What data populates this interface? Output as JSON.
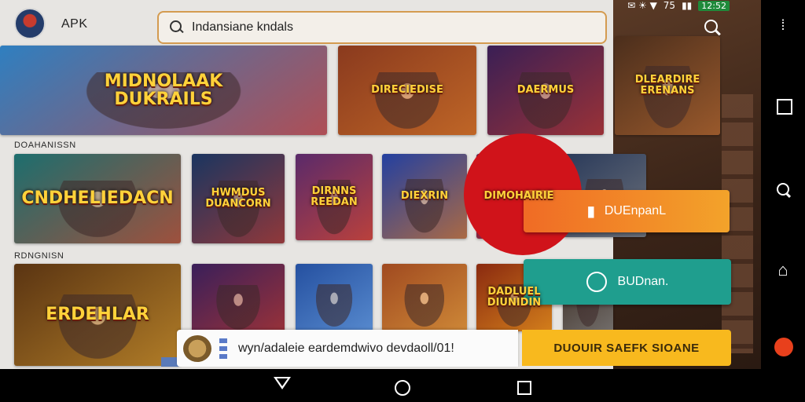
{
  "status_bar": {
    "time_text": "75",
    "battery_text": "12:52"
  },
  "header": {
    "app_name": "APK",
    "search_value": "Indansiane kndals"
  },
  "sections": {
    "first_label": "DOAHANISSN",
    "second_label": "RDNGNISN"
  },
  "hero_cards": [
    {
      "title": "MIDNOLAAK\nDUKRAILS",
      "bg": "#2f7fc0",
      "accent": "#e23b2b"
    },
    {
      "title": "DIRECIEDISE",
      "bg": "#8a3a1e",
      "accent": "#d4772a"
    },
    {
      "title": "DAERMUS",
      "bg": "#3a1f55",
      "accent": "#c0392b"
    },
    {
      "title": "DLEARDIRE\nERENANS",
      "bg": "#4b2e1c",
      "accent": "#b86a32"
    }
  ],
  "row1_cards": [
    {
      "title": "CNDHELIEDACN",
      "bg": "#1d6e6e",
      "accent": "#d2452a"
    },
    {
      "title": "HWMDUS\nDUANCORN",
      "bg": "#1a3560",
      "accent": "#c0392b"
    },
    {
      "title": "DIRNNS\nREEDAN",
      "bg": "#5a2a6a",
      "accent": "#e04a2a"
    },
    {
      "title": "DIEXRIN",
      "bg": "#2340a0",
      "accent": "#e07a20"
    },
    {
      "title": "DIMOHAIRIE",
      "bg": "#4a1a4a",
      "accent": "#d33"
    },
    {
      "title": "",
      "bg": "#2a3a5a",
      "accent": "#888"
    }
  ],
  "row2_cards": [
    {
      "title": "ERDEHLAR",
      "bg": "#5a3412",
      "accent": "#d49a30"
    },
    {
      "title": "",
      "bg": "#3a1f5a",
      "accent": "#c0392b"
    },
    {
      "title": "",
      "bg": "#2550a0",
      "accent": "#6aa0e0"
    },
    {
      "title": "",
      "bg": "#a04a20",
      "accent": "#e0a040"
    },
    {
      "title": "DADLUEL\nDIUNIDIN",
      "bg": "#8a2a10",
      "accent": "#f0a020"
    },
    {
      "title": "",
      "bg": "#3a2a20",
      "accent": "#888"
    }
  ],
  "actions": {
    "download_label": "DUEnpanL",
    "download_glyph": "🔒",
    "share_label": "BUDnan.",
    "cta_label": "DUOUIR SAEFK SIOANE"
  },
  "banner": {
    "text": "wyn/adaleie eardemdwivo devdaoll/01!"
  },
  "colors": {
    "accent_orange": "#f06b25",
    "teal": "#1f9e8e",
    "cta_yellow": "#f8b91e",
    "red": "#d0131a"
  }
}
